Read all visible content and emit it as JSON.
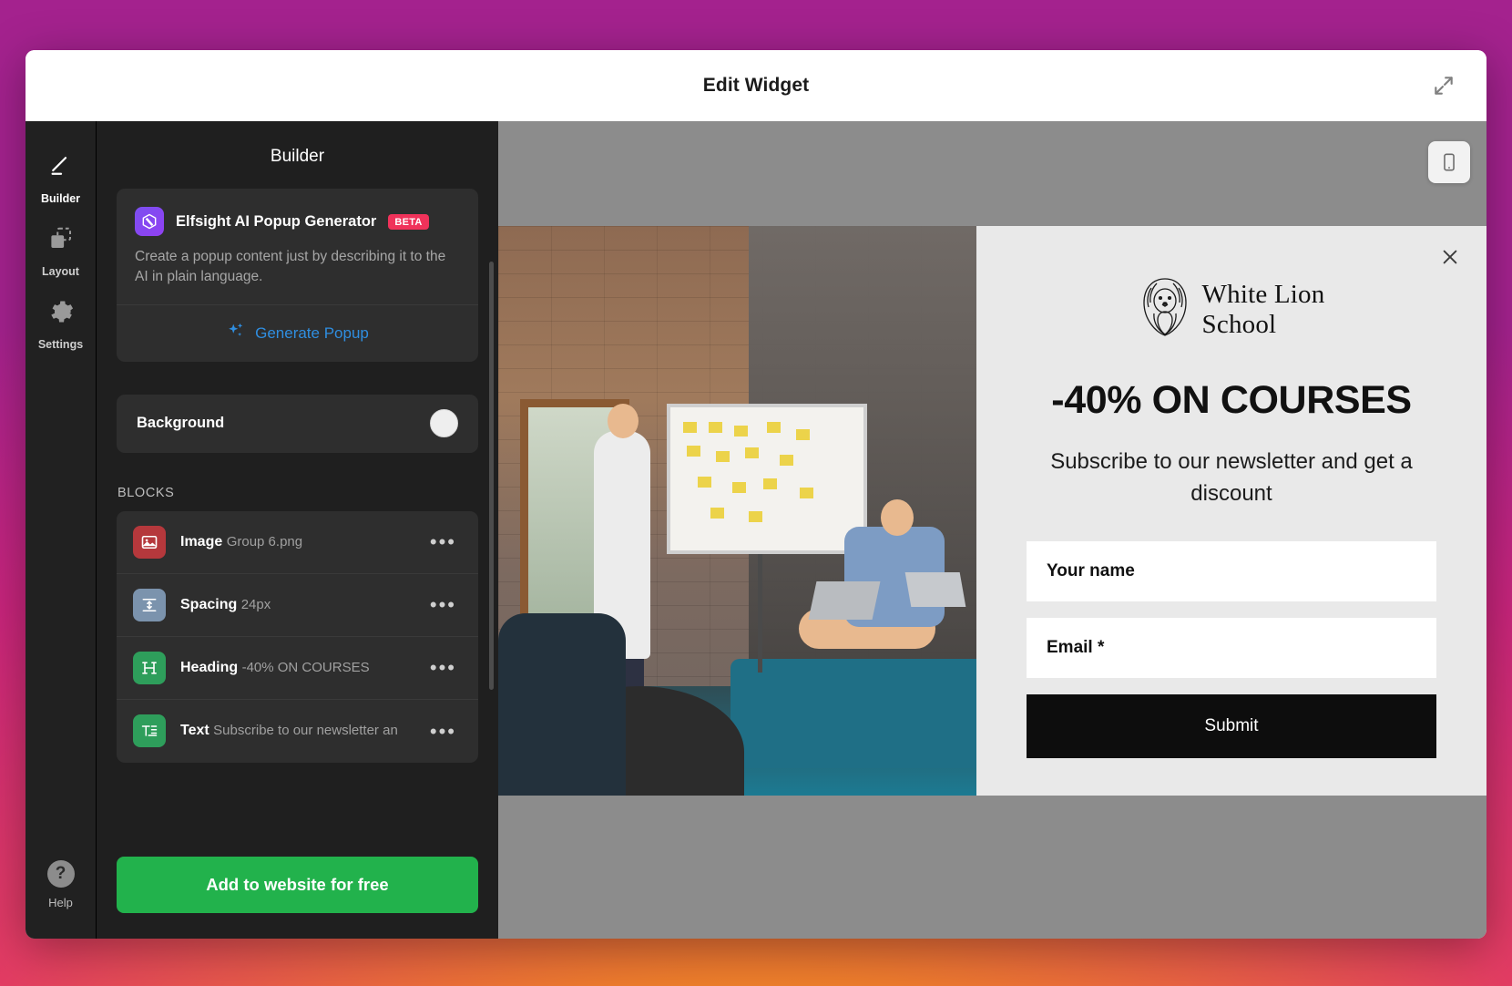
{
  "window": {
    "title": "Edit Widget",
    "expand_icon": "expand-arrows-icon"
  },
  "rail": {
    "items": [
      {
        "label": "Builder",
        "icon": "pencil-icon",
        "active": true
      },
      {
        "label": "Layout",
        "icon": "layout-icon",
        "active": false
      },
      {
        "label": "Settings",
        "icon": "gear-icon",
        "active": false
      }
    ],
    "help": {
      "label": "Help",
      "icon": "question-mark-icon"
    }
  },
  "panel": {
    "title": "Builder",
    "ai_card": {
      "logo_icon": "elfsight-logo-icon",
      "title": "Elfsight AI Popup Generator",
      "badge": "BETA",
      "description": "Create a popup content just by describing it to the AI in plain language.",
      "action_label": "Generate Popup",
      "action_icon": "sparkles-icon",
      "action_color": "#2f8ee0"
    },
    "background": {
      "label": "Background",
      "swatch_color": "#eeeeee"
    },
    "blocks_title": "BLOCKS",
    "blocks": [
      {
        "name": "Image",
        "sub": "Group 6.png",
        "icon": "image-icon",
        "color": "#b5383c",
        "more": "•••"
      },
      {
        "name": "Spacing",
        "sub": "24px",
        "icon": "spacing-icon",
        "color": "#7b93ad",
        "more": "•••"
      },
      {
        "name": "Heading",
        "sub": "-40% ON COURSES",
        "icon": "heading-icon",
        "color": "#2e9e5b",
        "more": "•••"
      },
      {
        "name": "Text",
        "sub": "Subscribe to our newsletter an",
        "icon": "text-icon",
        "color": "#2e9e5b",
        "more": "•••"
      }
    ],
    "cta_label": "Add to website for free",
    "cta_color": "#22b24c"
  },
  "preview": {
    "device_button_icon": "mobile-phone-icon",
    "popup": {
      "close_icon": "close-x-icon",
      "logo": {
        "icon": "lion-head-icon",
        "line1": "White Lion",
        "line2": "School"
      },
      "heading": "-40% ON COURSES",
      "subtext": "Subscribe to our newsletter and get a discount",
      "fields": [
        {
          "label": "Your name",
          "placeholder": "Your name"
        },
        {
          "label": "Email *",
          "placeholder": "Email *"
        }
      ],
      "submit_label": "Submit",
      "submit_color": "#0d0d0d"
    }
  }
}
